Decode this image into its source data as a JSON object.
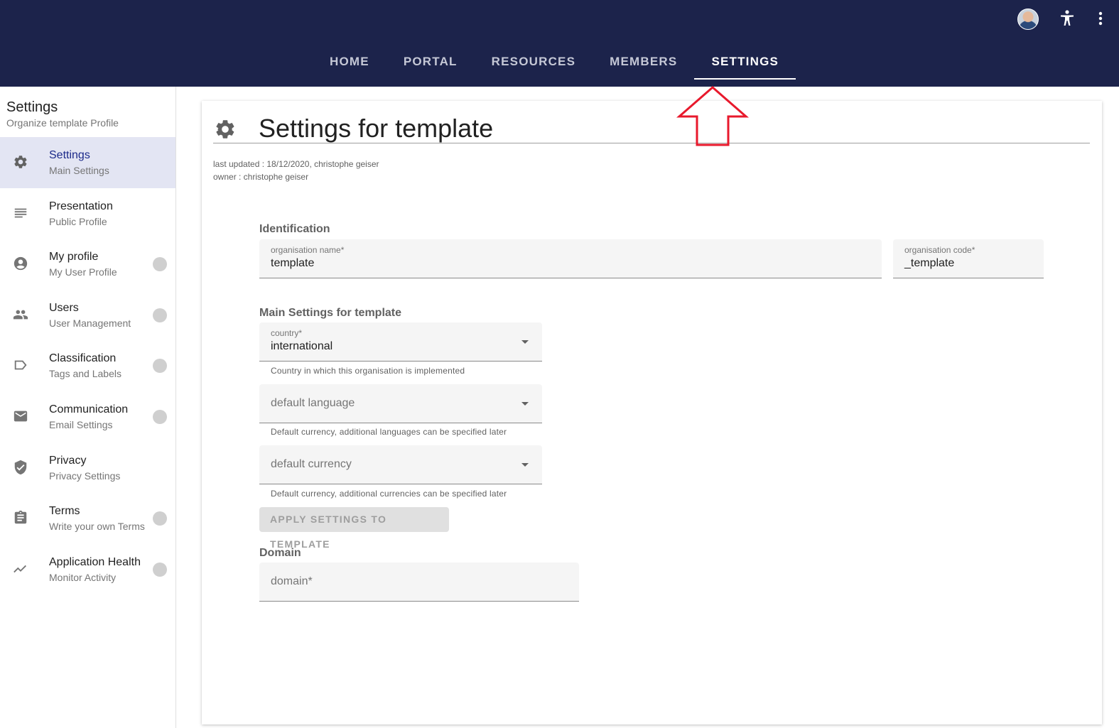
{
  "topbar": {
    "tabs": [
      {
        "label": "HOME"
      },
      {
        "label": "PORTAL"
      },
      {
        "label": "RESOURCES"
      },
      {
        "label": "MEMBERS"
      },
      {
        "label": "SETTINGS"
      }
    ],
    "active_tab": "SETTINGS",
    "icons": [
      "avatar",
      "accessibility-icon",
      "more-vert-icon"
    ]
  },
  "sidebar": {
    "title": "Settings",
    "subtitle": "Organize template Profile",
    "items": [
      {
        "label": "Settings",
        "sublabel": "Main Settings",
        "icon": "gear-icon",
        "active": true,
        "badge": false
      },
      {
        "label": "Presentation",
        "sublabel": "Public Profile",
        "icon": "notes-icon",
        "active": false,
        "badge": false
      },
      {
        "label": "My profile",
        "sublabel": "My User Profile",
        "icon": "account-circle-icon",
        "active": false,
        "badge": true
      },
      {
        "label": "Users",
        "sublabel": "User Management",
        "icon": "people-icon",
        "active": false,
        "badge": true
      },
      {
        "label": "Classification",
        "sublabel": "Tags and Labels",
        "icon": "label-icon",
        "active": false,
        "badge": true
      },
      {
        "label": "Communication",
        "sublabel": "Email Settings",
        "icon": "mail-icon",
        "active": false,
        "badge": true
      },
      {
        "label": "Privacy",
        "sublabel": "Privacy Settings",
        "icon": "shield-check-icon",
        "active": false,
        "badge": false
      },
      {
        "label": "Terms",
        "sublabel": "Write your own Terms",
        "icon": "clipboard-icon",
        "active": false,
        "badge": true
      },
      {
        "label": "Application Health",
        "sublabel": "Monitor Activity",
        "icon": "trending-icon",
        "active": false,
        "badge": true
      }
    ]
  },
  "main": {
    "title": "Settings for template",
    "last_updated": "last updated : 18/12/2020, christophe geiser",
    "owner": "owner : christophe geiser",
    "identification": {
      "section_label": "Identification",
      "org_name_label": "organisation name*",
      "org_name_value": "template",
      "org_code_label": "organisation code*",
      "org_code_value": "_template"
    },
    "main_settings": {
      "section_label": "Main Settings for template",
      "country_label": "country*",
      "country_value": "international",
      "country_hint": "Country in which this organisation is implemented",
      "language_placeholder": "default language",
      "language_hint": "Default currency, additional languages can be specified later",
      "currency_placeholder": "default currency",
      "currency_hint": "Default currency, additional currencies can be specified later",
      "apply_button": "APPLY SETTINGS TO TEMPLATE"
    },
    "domain": {
      "section_label": "Domain",
      "domain_placeholder": "domain*"
    }
  },
  "colors": {
    "topbar_bg": "#1c234b",
    "active_nav_bg": "#e3e5f3",
    "annotation": "#e8192c"
  }
}
